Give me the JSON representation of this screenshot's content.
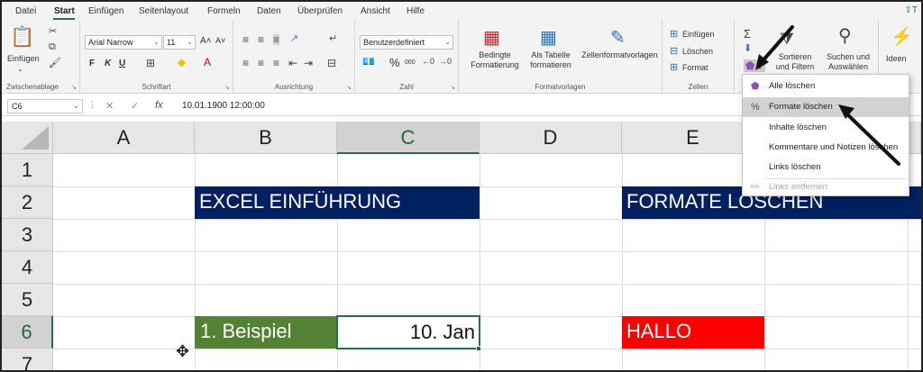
{
  "menubar": {
    "tabs": [
      "Datei",
      "Start",
      "Einfügen",
      "Seitenlayout",
      "Formeln",
      "Daten",
      "Überprüfen",
      "Ansicht",
      "Hilfe"
    ],
    "active_tab": "Start"
  },
  "ribbon": {
    "clipboard": {
      "paste_label": "Einfügen",
      "group_label": "Zwischenablage"
    },
    "font": {
      "font_name": "Arial Narrow",
      "font_size": "11",
      "grow": "A˄",
      "shrink": "A˅",
      "bold": "F",
      "italic": "K",
      "underline": "U",
      "group_label": "Schriftart"
    },
    "alignment": {
      "group_label": "Ausrichtung"
    },
    "number": {
      "format": "Benutzerdefiniert",
      "percent": "%",
      "thousands": "000",
      "group_label": "Zahl"
    },
    "styles": {
      "conditional": "Bedingte Formatierung",
      "as_table": "Als Tabelle formatieren",
      "cell_styles": "Zellenformatvorlagen",
      "group_label": "Formatvorlagen"
    },
    "cells": {
      "insert": "Einfügen",
      "delete": "Löschen",
      "format": "Format",
      "group_label": "Zellen"
    },
    "editing": {
      "sort_filter": "Sortieren und Filtern",
      "find_select": "Suchen und Auswählen"
    },
    "ideas": {
      "label": "Ideen"
    }
  },
  "formula_bar": {
    "name_box": "C6",
    "formula": "10.01.1900  12:00:00"
  },
  "grid": {
    "columns": [
      "A",
      "B",
      "C",
      "D",
      "E"
    ],
    "rows": [
      "1",
      "2",
      "3",
      "4",
      "5",
      "6",
      "7"
    ],
    "selected_column": "C",
    "selected_row": "6",
    "cells": {
      "b2": "EXCEL EINFÜHRUNG",
      "e2": "FORMATE LÖSCHEN",
      "b6": "1. Beispiel",
      "c6": "10. Jan",
      "e6": "HALLO"
    }
  },
  "clear_menu": {
    "items": [
      {
        "label": "Alle löschen",
        "icon": "eraser-icon"
      },
      {
        "label": "Formate löschen",
        "icon": "percent-eraser-icon"
      },
      {
        "label": "Inhalte löschen",
        "icon": ""
      },
      {
        "label": "Kommentare und Notizen löschen",
        "icon": ""
      },
      {
        "label": "Links löschen",
        "icon": ""
      },
      {
        "label": "Links entfernen",
        "icon": "link-icon"
      }
    ],
    "hovered_index": 1
  },
  "colors": {
    "title_fill": "#002060",
    "green_fill": "#548235",
    "red_fill": "#ff0000",
    "accent": "#217346"
  }
}
